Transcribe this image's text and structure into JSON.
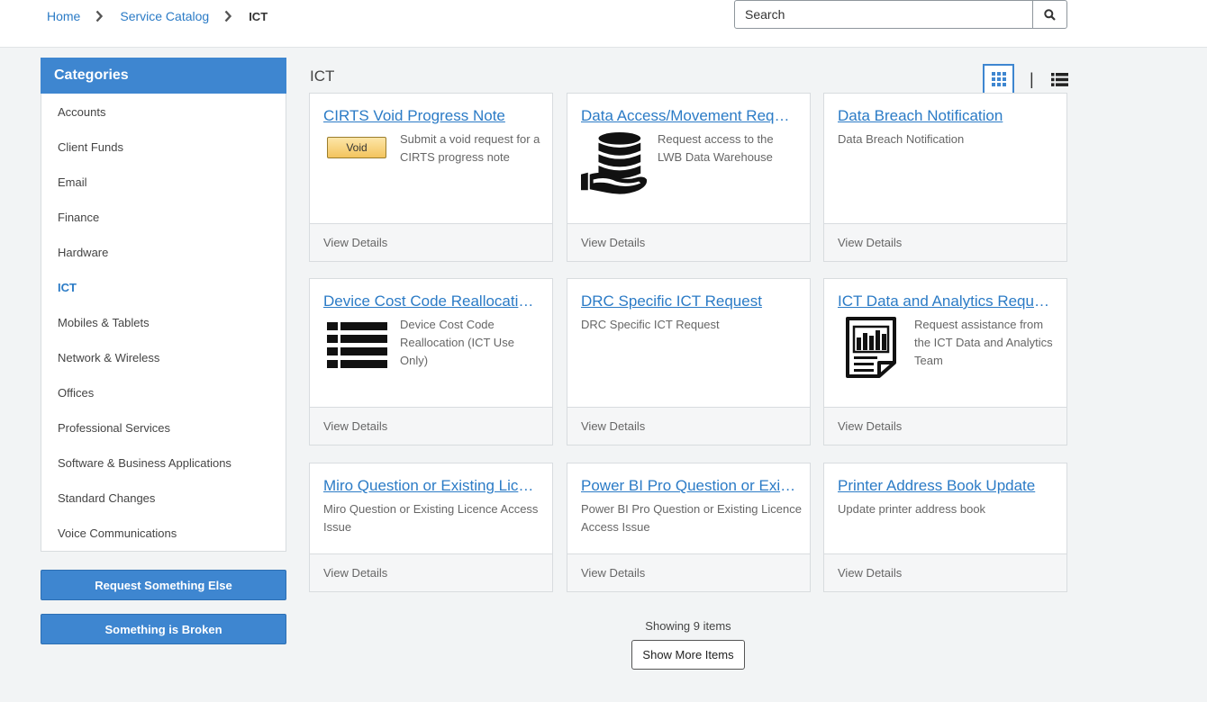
{
  "breadcrumb": {
    "home": "Home",
    "catalog": "Service Catalog",
    "current": "ICT"
  },
  "search": {
    "placeholder": "Search"
  },
  "sidebar": {
    "title": "Categories",
    "items": [
      {
        "label": "Accounts"
      },
      {
        "label": "Client Funds"
      },
      {
        "label": "Email"
      },
      {
        "label": "Finance"
      },
      {
        "label": "Hardware"
      },
      {
        "label": "ICT",
        "active": true
      },
      {
        "label": "Mobiles & Tablets"
      },
      {
        "label": "Network & Wireless"
      },
      {
        "label": "Offices"
      },
      {
        "label": "Professional Services"
      },
      {
        "label": "Software & Business Applications"
      },
      {
        "label": "Standard Changes"
      },
      {
        "label": "Voice Communications"
      }
    ],
    "request_else": "Request Something Else",
    "broken": "Something is Broken"
  },
  "main": {
    "title": "ICT",
    "view_separator": "|",
    "cards": [
      {
        "title": "CIRTS Void Progress Note",
        "desc": "Submit a void request for a CIRTS progress note",
        "image": "void-badge",
        "badge_text": "Void",
        "footer": "View Details"
      },
      {
        "title": "Data Access/Movement Request",
        "desc": "Request access to the LWB Data Warehouse",
        "image": "database-hand-icon",
        "footer": "View Details"
      },
      {
        "title": "Data Breach Notification",
        "desc": "Data Breach Notification",
        "image": null,
        "footer": "View Details"
      },
      {
        "title": "Device Cost Code Reallocation (ICT Use Only)",
        "desc": "Device Cost Code Reallocation (ICT Use Only)",
        "image": "list-icon",
        "footer": "View Details"
      },
      {
        "title": "DRC Specific ICT Request",
        "desc": "DRC Specific ICT Request",
        "image": null,
        "footer": "View Details"
      },
      {
        "title": "ICT Data and Analytics Request",
        "desc": "Request assistance from the ICT Data and Analytics Team",
        "image": "report-chart-icon",
        "footer": "View Details"
      },
      {
        "title": "Miro Question or Existing Licence Access Issue",
        "desc": "Miro Question or Existing Licence Access Issue",
        "image": null,
        "footer": "View Details"
      },
      {
        "title": "Power BI Pro Question or Existing Licence Access Issue",
        "desc": "Power BI Pro Question or Existing Licence Access Issue",
        "image": null,
        "footer": "View Details"
      },
      {
        "title": "Printer Address Book Update",
        "desc": "Update printer address book",
        "image": null,
        "footer": "View Details"
      }
    ],
    "showing": "Showing 9 items",
    "show_more": "Show More Items"
  },
  "colors": {
    "accent": "#3e86d0",
    "link": "#2b7bc6"
  }
}
